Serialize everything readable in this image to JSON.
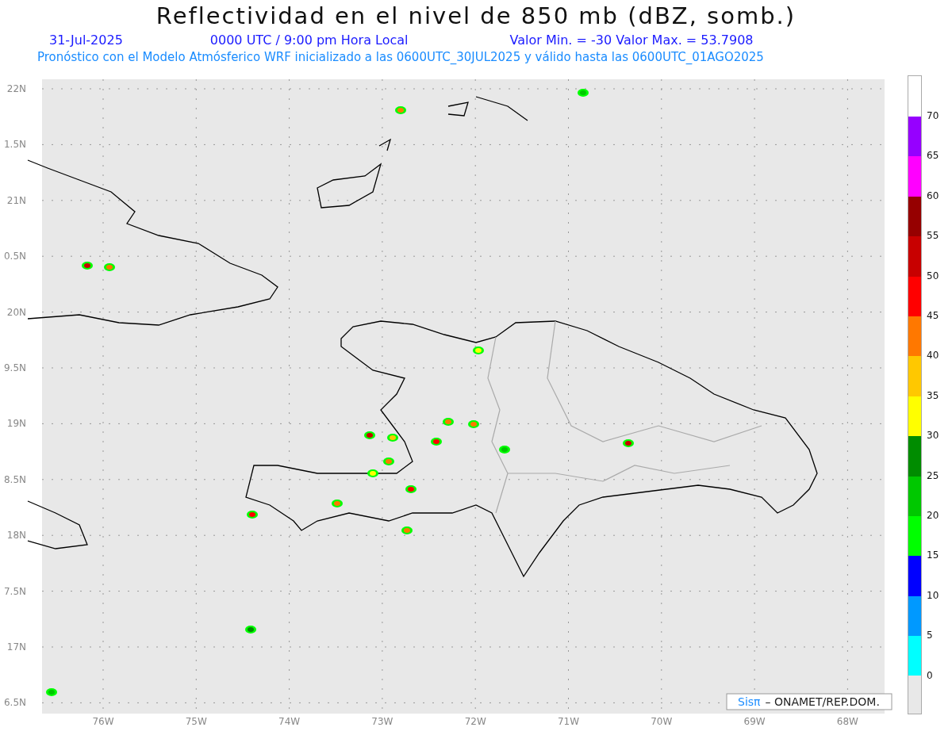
{
  "title": "Reflectividad en el nivel de 850 mb (dBZ, somb.)",
  "info": {
    "date": "31-Jul-2025",
    "time": "0000 UTC / 9:00 pm Hora Local",
    "range": "Valor Min. = -30  Valor Max. = 53.7908"
  },
  "subtitle": "Pronóstico con el Modelo Atmósferico WRF inicializado a las 0600UTC_30JUL2025 y válido hasta las  0600UTC_01AGO2025",
  "map": {
    "lat_labels": [
      "22N",
      "1.5N",
      "21N",
      "0.5N",
      "20N",
      "9.5N",
      "19N",
      "8.5N",
      "18N",
      "7.5N",
      "17N",
      "6.5N"
    ],
    "lon_labels": [
      "76W",
      "75W",
      "74W",
      "73W",
      "72W",
      "71W",
      "70W",
      "69W",
      "68W"
    ],
    "credit": {
      "brand": "Sisπ",
      "text": "– ONAMET/REP.DOM."
    }
  },
  "colorbar": {
    "labels": [
      "70",
      "65",
      "60",
      "55",
      "50",
      "45",
      "40",
      "35",
      "30",
      "25",
      "20",
      "15",
      "10",
      "5",
      "0"
    ],
    "segments": [
      {
        "color": "#9600ff"
      },
      {
        "color": "#ff00ff"
      },
      {
        "color": "#960000"
      },
      {
        "color": "#c80000"
      },
      {
        "color": "#ff0000"
      },
      {
        "color": "#ff7800"
      },
      {
        "color": "#ffc800"
      },
      {
        "color": "#ffff00"
      },
      {
        "color": "#008c00"
      },
      {
        "color": "#00c800"
      },
      {
        "color": "#00ff00"
      },
      {
        "color": "#0000ff"
      },
      {
        "color": "#0099ff"
      },
      {
        "color": "#00ffff"
      }
    ]
  }
}
